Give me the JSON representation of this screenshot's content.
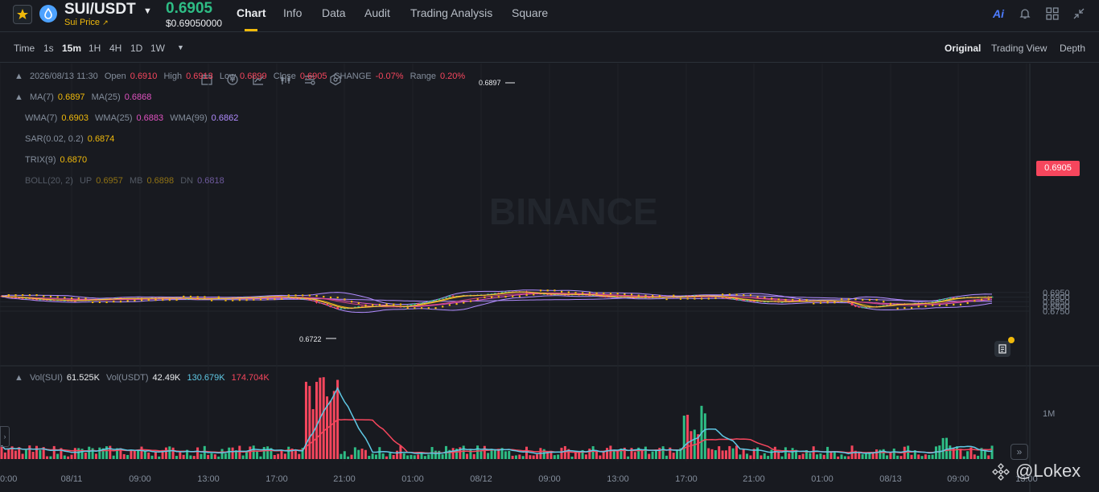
{
  "header": {
    "pair": "SUI/USDT",
    "subtitle": "Sui Price",
    "price": "0.6905",
    "price_usd": "$0.69050000",
    "tabs": [
      "Chart",
      "Info",
      "Data",
      "Audit",
      "Trading Analysis",
      "Square"
    ],
    "ai_label": "Ai"
  },
  "toolbar": {
    "time_label": "Time",
    "intervals": [
      "1s",
      "15m",
      "1H",
      "4H",
      "1D",
      "1W"
    ],
    "active_interval": "15m",
    "views": [
      "Original",
      "Trading View",
      "Depth"
    ],
    "active_view": "Original"
  },
  "legend": {
    "ohlc": {
      "date": "2026/08/13 11:30",
      "open_label": "Open",
      "open": "0.6910",
      "high_label": "High",
      "high": "0.6913",
      "low_label": "Low",
      "low": "0.6899",
      "close_label": "Close",
      "close": "0.6905",
      "change_label": "CHANGE",
      "change": "-0.07%",
      "range_label": "Range",
      "range": "0.20%"
    },
    "ma": {
      "label": "MA(7)",
      "v1": "0.6897",
      "label2": "MA(25)",
      "v2": "0.6868"
    },
    "wma": {
      "label": "WMA(7)",
      "v1": "0.6903",
      "label2": "WMA(25)",
      "v2": "0.6883",
      "label3": "WMA(99)",
      "v3": "0.6862"
    },
    "sar": {
      "label": "SAR(0.02, 0.2)",
      "v": "0.6874"
    },
    "trix": {
      "label": "TRIX(9)",
      "v": "0.6870"
    },
    "boll": {
      "label": "BOLL(20, 2)",
      "up": "UP",
      "up_v": "0.6957",
      "mb": "MB",
      "mb_v": "0.6898",
      "dn": "DN",
      "dn_v": "0.6818"
    },
    "vol": {
      "label": "Vol(SUI)",
      "v": "61.525K",
      "label2": "Vol(USDT)",
      "v2": "42.49K",
      "v3": "130.679K",
      "v4": "174.704K"
    }
  },
  "watermark": "BINANCE",
  "watermark_logo": "Lokex",
  "watermark_at": "@",
  "price_tag": "0.6905",
  "chart_data": {
    "type": "candlestick",
    "y_ticks": [
      0.675,
      0.68,
      0.685,
      0.69,
      0.695
    ],
    "y_tick_labels": [
      "0.6750",
      "0.6800",
      "0.6850",
      "0.6900",
      "0.6950"
    ],
    "ylim": [
      0.6714,
      0.6984
    ],
    "x_ticks": [
      "0:00",
      "08/11",
      "09:00",
      "13:00",
      "17:00",
      "21:00",
      "01:00",
      "08/12",
      "09:00",
      "13:00",
      "17:00",
      "21:00",
      "01:00",
      "08/13",
      "09:00",
      "13:00"
    ],
    "high_marker": "0.6897",
    "low_marker": "0.6722",
    "volume_tick": "1M",
    "colors": {
      "up": "#2ebd85",
      "down": "#f6465d",
      "ma7": "#f0b90b",
      "ma25": "#e052c0",
      "boll": "#b18cff",
      "sar": "#f0b90b"
    }
  }
}
